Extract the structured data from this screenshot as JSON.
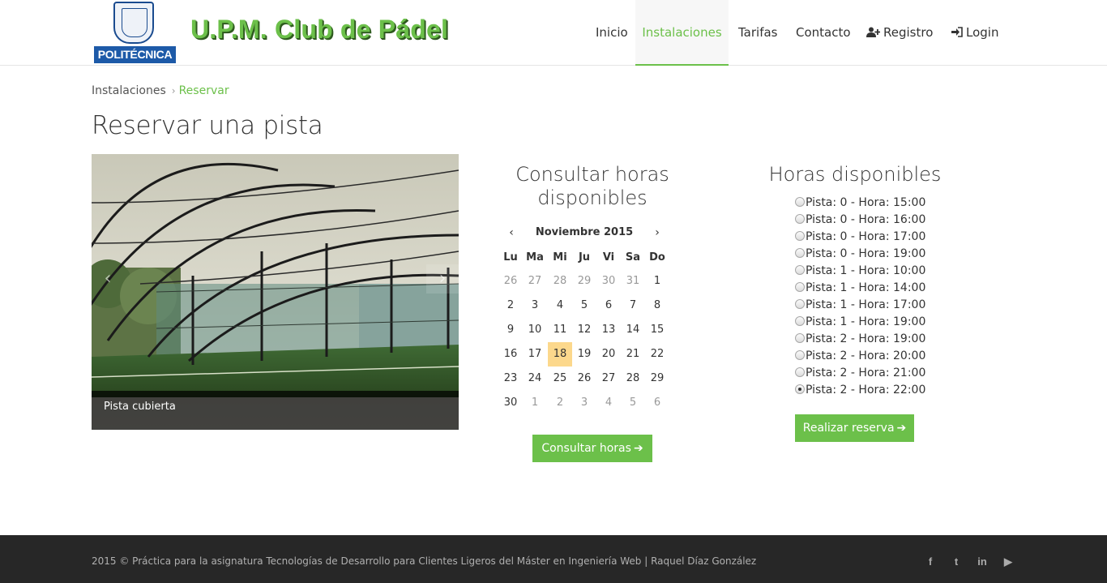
{
  "header": {
    "logo_text": "POLITÉCNICA",
    "site_title": "U.P.M. Club de Pádel",
    "nav": [
      {
        "label": "Inicio",
        "active": false
      },
      {
        "label": "Instalaciones",
        "active": true
      },
      {
        "label": "Tarifas",
        "active": false
      },
      {
        "label": "Contacto",
        "active": false
      },
      {
        "label": "Registro",
        "icon": "user-plus-icon",
        "active": false
      },
      {
        "label": "Login",
        "icon": "sign-in-icon",
        "active": false
      }
    ]
  },
  "breadcrumb": {
    "parent": "Instalaciones",
    "separator": "›",
    "current": "Reservar"
  },
  "page_title": "Reservar una pista",
  "carousel": {
    "caption": "Pista cubierta",
    "prev_icon": "chevron-left-icon",
    "next_icon": "chevron-right-icon"
  },
  "calendar": {
    "heading_line1": "Consultar horas",
    "heading_line2": "disponibles",
    "prev": "‹",
    "next": "›",
    "month_label": "Noviembre 2015",
    "weekdays": [
      "Lu",
      "Ma",
      "Mi",
      "Ju",
      "Vi",
      "Sa",
      "Do"
    ],
    "weeks": [
      [
        "26",
        "27",
        "28",
        "29",
        "30",
        "31",
        "1"
      ],
      [
        "2",
        "3",
        "4",
        "5",
        "6",
        "7",
        "8"
      ],
      [
        "9",
        "10",
        "11",
        "12",
        "13",
        "14",
        "15"
      ],
      [
        "16",
        "17",
        "18",
        "19",
        "20",
        "21",
        "22"
      ],
      [
        "23",
        "24",
        "25",
        "26",
        "27",
        "28",
        "29"
      ],
      [
        "30",
        "1",
        "2",
        "3",
        "4",
        "5",
        "6"
      ]
    ],
    "selected_day": "18",
    "button_label": "Consultar horas"
  },
  "hours": {
    "heading": "Horas disponibles",
    "slots": [
      {
        "label": "Pista: 0 - Hora: 15:00",
        "checked": false
      },
      {
        "label": "Pista: 0 - Hora: 16:00",
        "checked": false
      },
      {
        "label": "Pista: 0 - Hora: 17:00",
        "checked": false
      },
      {
        "label": "Pista: 0 - Hora: 19:00",
        "checked": false
      },
      {
        "label": "Pista: 1 - Hora: 10:00",
        "checked": false
      },
      {
        "label": "Pista: 1 - Hora: 14:00",
        "checked": false
      },
      {
        "label": "Pista: 1 - Hora: 17:00",
        "checked": false
      },
      {
        "label": "Pista: 1 - Hora: 19:00",
        "checked": false
      },
      {
        "label": "Pista: 2 - Hora: 19:00",
        "checked": false
      },
      {
        "label": "Pista: 2 - Hora: 20:00",
        "checked": false
      },
      {
        "label": "Pista: 2 - Hora: 21:00",
        "checked": false
      },
      {
        "label": "Pista: 2 - Hora: 22:00",
        "checked": true
      }
    ],
    "button_label": "Realizar reserva"
  },
  "footer": {
    "text": "2015 © Práctica para la asignatura Tecnologías de Desarrollo para Clientes Ligeros del Máster en Ingeniería Web | Raquel Díaz González",
    "social": [
      {
        "name": "facebook-icon",
        "glyph": "f"
      },
      {
        "name": "twitter-icon",
        "glyph": "t"
      },
      {
        "name": "linkedin-icon",
        "glyph": "in"
      },
      {
        "name": "youtube-icon",
        "glyph": "▶"
      }
    ]
  },
  "colors": {
    "accent": "#6cc04a",
    "today_highlight": "#fcd88c",
    "footer_bg": "#272727",
    "logo_blue": "#1d5aa8"
  }
}
